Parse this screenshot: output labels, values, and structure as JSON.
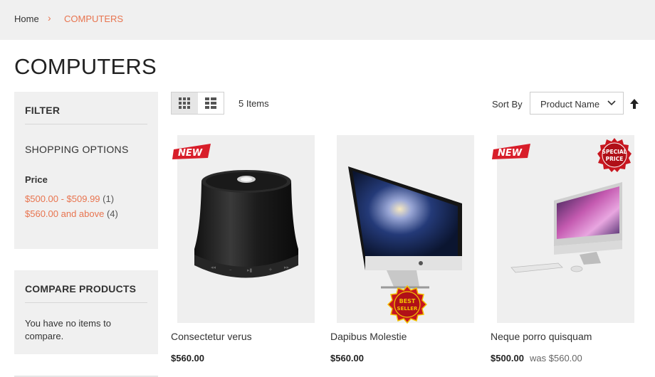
{
  "breadcrumb": {
    "home": "Home",
    "separator": "›",
    "current": "COMPUTERS"
  },
  "page_title": "COMPUTERS",
  "filter": {
    "title": "FILTER",
    "shopping_options": "SHOPPING OPTIONS",
    "price_label": "Price",
    "price_options": [
      {
        "label": "$500.00 - $509.99",
        "count": "(1)"
      },
      {
        "label": "$560.00 and above",
        "count": "(4)"
      }
    ]
  },
  "compare": {
    "title": "COMPARE PRODUCTS",
    "empty_text": "You have no items to compare."
  },
  "toolbar": {
    "items_count": "5 Items",
    "sort_label": "Sort By",
    "sort_value": "Product Name",
    "view_modes": [
      "grid",
      "list"
    ],
    "active_view": "grid"
  },
  "products": [
    {
      "name": "Consectetur verus",
      "price": "$560.00",
      "badge": "NEW",
      "image_icon": "speaker-icon"
    },
    {
      "name": "Dapibus Molestie",
      "price": "$560.00",
      "badge": "BEST SELLER",
      "image_icon": "monitor-icon"
    },
    {
      "name": "Neque porro quisquam",
      "price": "$500.00",
      "was_label": "was",
      "old_price": "$560.00",
      "badge": "NEW",
      "badge2": "SPECIAL PRICE",
      "image_icon": "imac-icon"
    }
  ],
  "colors": {
    "accent": "#e8744f",
    "badge_red": "#d81e2a",
    "panel_bg": "#f0f0f0"
  }
}
